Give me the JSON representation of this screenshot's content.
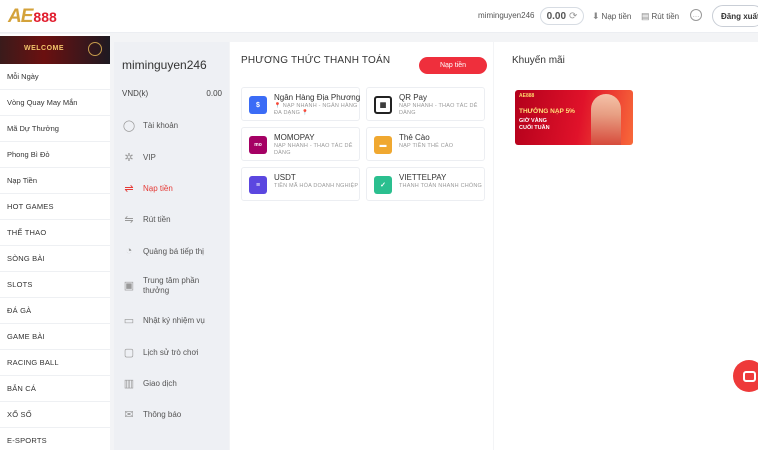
{
  "header": {
    "logo_mark": "AE",
    "logo_num": "888",
    "username": "miminguyen246",
    "balance": "0.00",
    "deposit_link": "Nạp tiền",
    "withdraw_link": "Rút tiền",
    "logout": "Đăng xuất"
  },
  "sidebar": {
    "banner_text": "WELCOME",
    "items": [
      "Mỗi Ngày",
      "Vòng Quay May Mắn",
      "Mã Dự Thưởng",
      "Phong Bì Đỏ",
      "Nạp Tiền",
      "HOT GAMES",
      "THỂ THAO",
      "SÒNG BÀI",
      "SLOTS",
      "ĐÁ GÀ",
      "GAME BÀI",
      "RACING BALL",
      "BẮN CÁ",
      "XỔ SỐ",
      "E-SPORTS"
    ]
  },
  "account": {
    "username": "miminguyen246",
    "currency": "VND(k)",
    "balance": "0.00",
    "menu": [
      {
        "label": "Tài khoản",
        "icon": "user-icon"
      },
      {
        "label": "VIP",
        "icon": "gear-icon"
      },
      {
        "label": "Nạp tiền",
        "icon": "deposit-icon"
      },
      {
        "label": "Rút tiền",
        "icon": "withdraw-icon"
      },
      {
        "label": "Quảng bá tiếp thị",
        "icon": "megaphone-icon"
      },
      {
        "label": "Trung tâm phần thưởng",
        "icon": "gift-icon"
      },
      {
        "label": "Nhật ký nhiệm vụ",
        "icon": "clipboard-icon"
      },
      {
        "label": "Lịch sử trò chơi",
        "icon": "history-icon"
      },
      {
        "label": "Giao dịch",
        "icon": "transaction-icon"
      },
      {
        "label": "Thông báo",
        "icon": "mail-icon"
      }
    ]
  },
  "payment": {
    "title": "PHƯƠNG THỨC THANH TOÁN",
    "deposit_button": "Nạp tiền",
    "methods": [
      {
        "name": "Ngân Hàng Địa Phương",
        "desc": "📍 NẠP NHANH - NGÂN HÀNG ĐA DẠNG 📍",
        "icon": "bank-icon",
        "color": "#3b6cf6"
      },
      {
        "name": "QR Pay",
        "desc": "NẠP NHANH - THAO TÁC DỄ DÀNG",
        "icon": "qr-icon",
        "color": "#222222"
      },
      {
        "name": "MOMOPAY",
        "desc": "NẠP NHANH - THAO TÁC DỄ DÀNG",
        "icon": "momo-icon",
        "color": "#a50064"
      },
      {
        "name": "Thẻ Cào",
        "desc": "NẠP TIỀN THẺ CÀO",
        "icon": "card-icon",
        "color": "#f0a830"
      },
      {
        "name": "USDT",
        "desc": "TIỀN MÃ HÓA DOANH NGHIỆP",
        "icon": "usdt-icon",
        "color": "#5b47e0"
      },
      {
        "name": "VIETTELPAY",
        "desc": "THANH TOÁN NHANH CHÓNG",
        "icon": "viettelpay-icon",
        "color": "#2bbf8f"
      }
    ]
  },
  "promo": {
    "title": "Khuyến mãi",
    "banner_logo": "AE888",
    "banner_line1": "THƯỞNG NẠP 5%",
    "banner_line2": "GIỜ VÀNG",
    "banner_line3": "CUỐI TUẦN"
  }
}
